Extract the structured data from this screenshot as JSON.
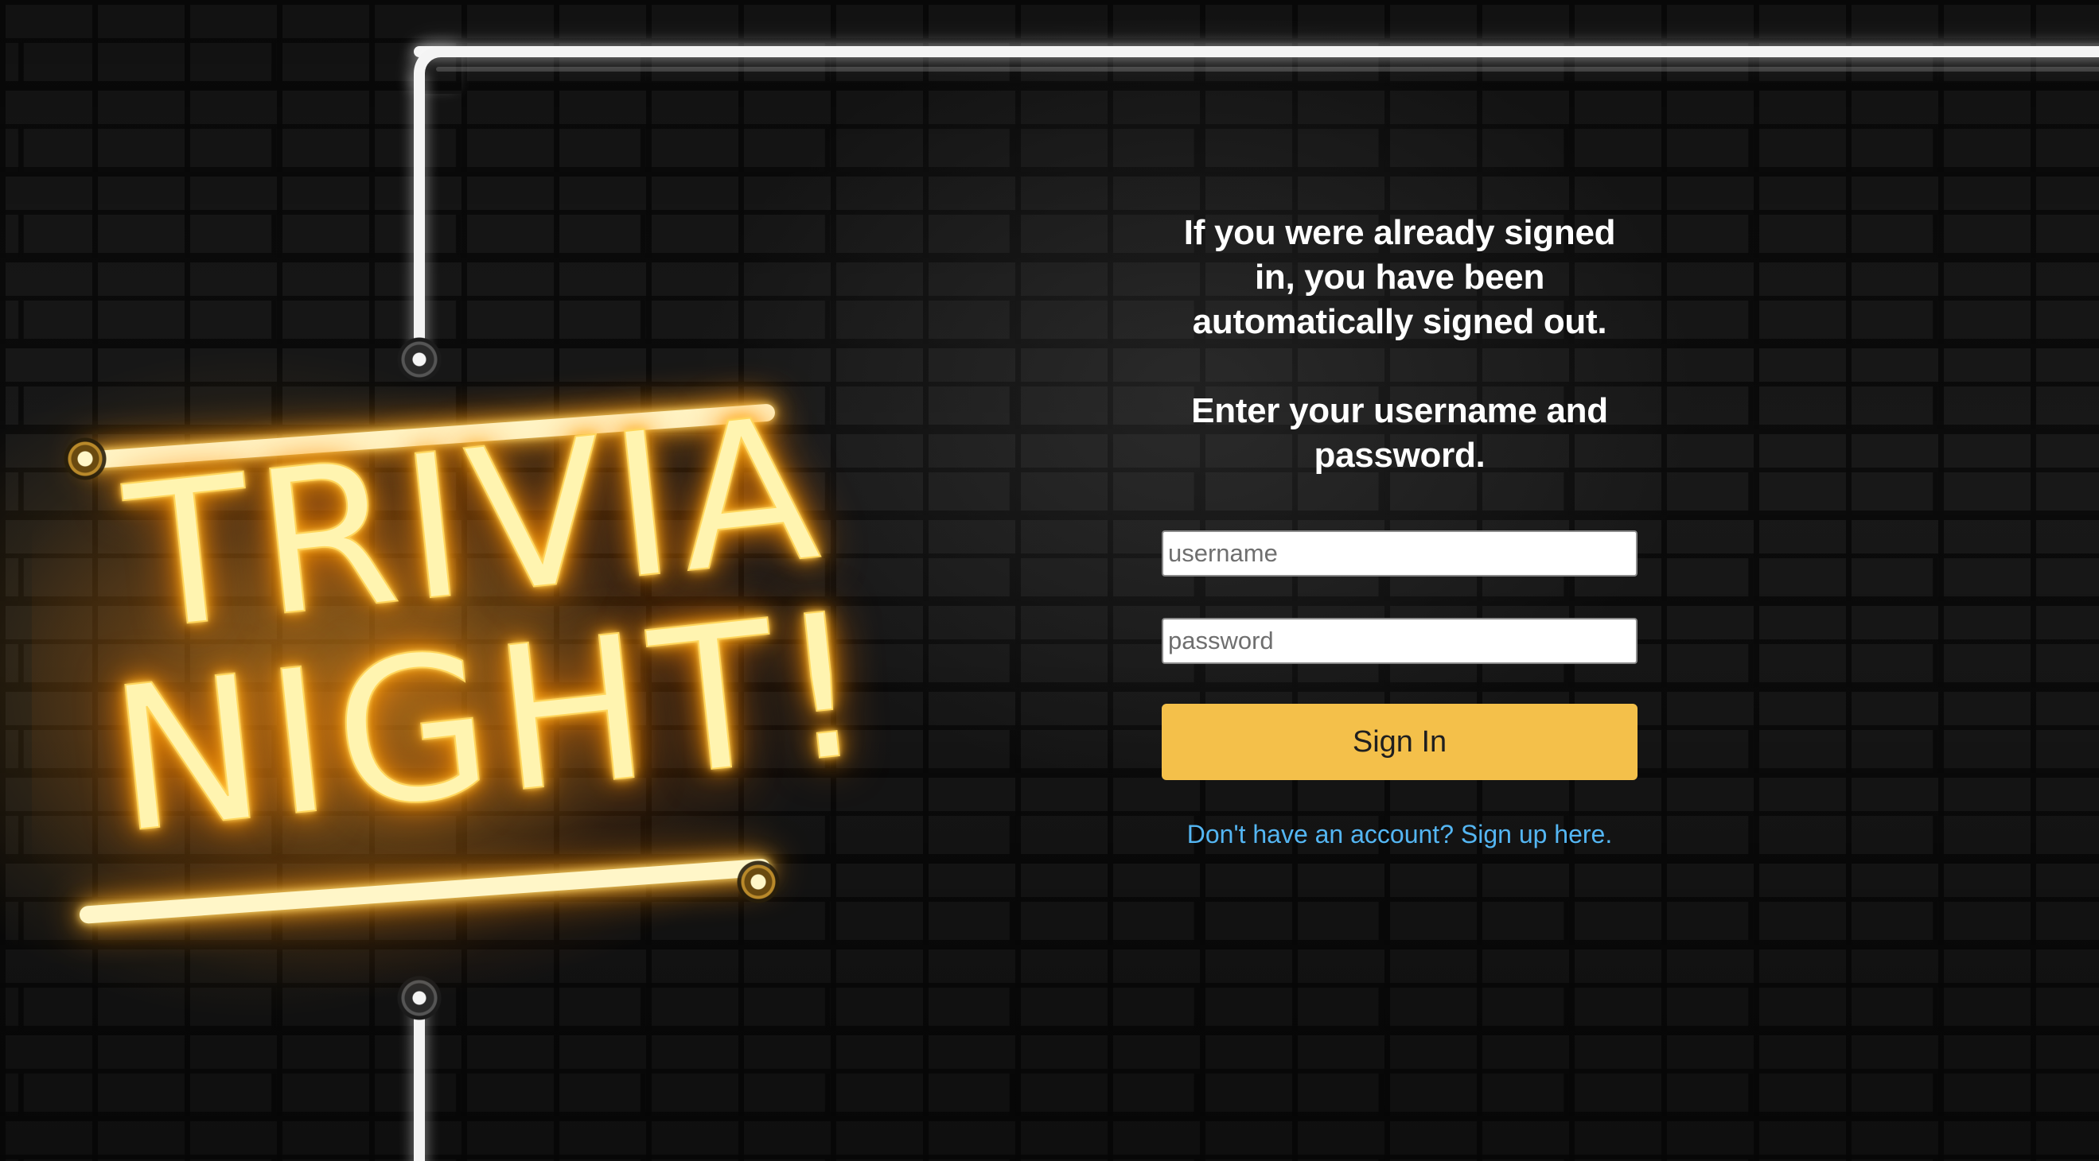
{
  "sign": {
    "line1": "TRIVIA",
    "line2": "NIGHT!"
  },
  "login": {
    "message_signed_out": "If you were already signed in, you have been automatically signed out.",
    "message_instructions": "Enter your username and password.",
    "username_placeholder": "username",
    "password_placeholder": "password",
    "signin_label": "Sign In",
    "signup_link": "Don't have an account? Sign up here."
  },
  "colors": {
    "accent_button": "#f4c04a",
    "link": "#54b6f3",
    "neon": "#ffb62e"
  },
  "icons": {
    "sign": "neon-sign-icon",
    "frame": "neon-frame-icon"
  }
}
